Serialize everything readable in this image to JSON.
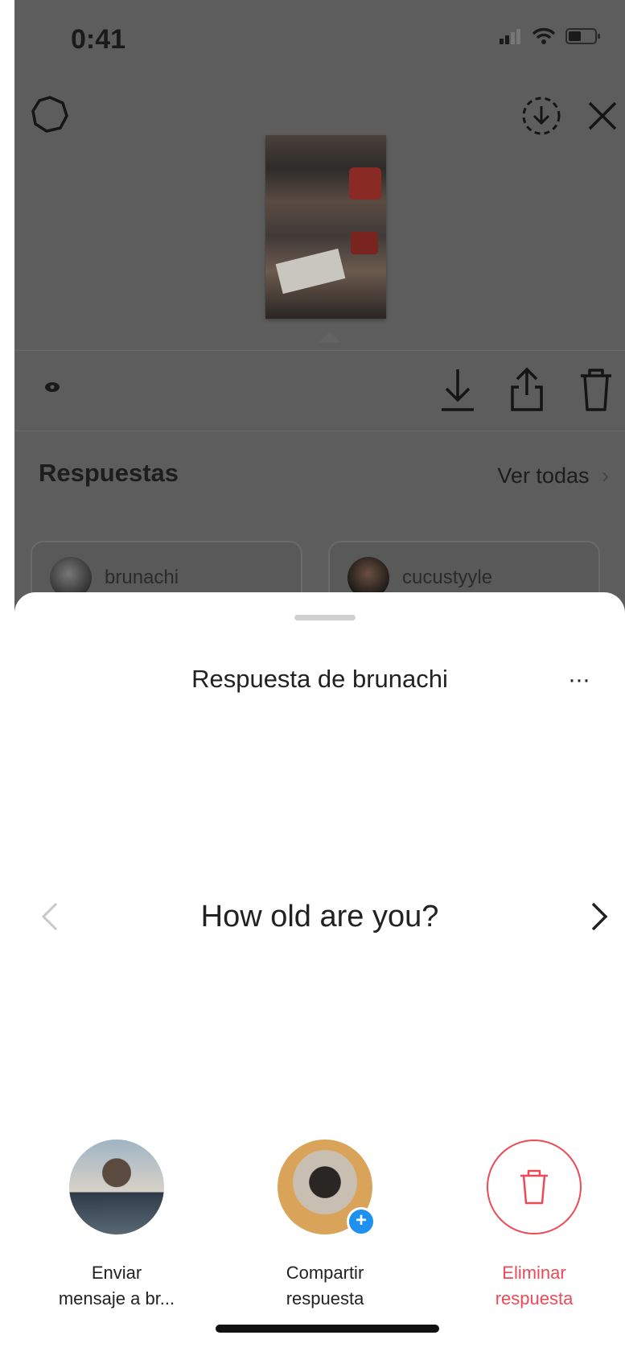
{
  "status_bar": {
    "time": "0:41"
  },
  "story": {
    "icons": [
      "settings-icon",
      "save-icon",
      "close-icon",
      "eye-icon",
      "download-icon",
      "share-icon",
      "trash-icon"
    ]
  },
  "responses": {
    "header": "Respuestas",
    "view_all": "Ver todas",
    "cards": [
      {
        "username": "brunachi"
      },
      {
        "username": "cucustyyle"
      }
    ]
  },
  "sheet": {
    "title": "Respuesta de brunachi",
    "more": "···",
    "question": "How old are you?",
    "actions": [
      {
        "label": "Enviar\nmensaje a br..."
      },
      {
        "label": "Compartir\nrespuesta"
      },
      {
        "label": "Eliminar\nrespuesta"
      }
    ],
    "colors": {
      "destructive": "#ed4956",
      "badge": "#1e90f0"
    }
  }
}
